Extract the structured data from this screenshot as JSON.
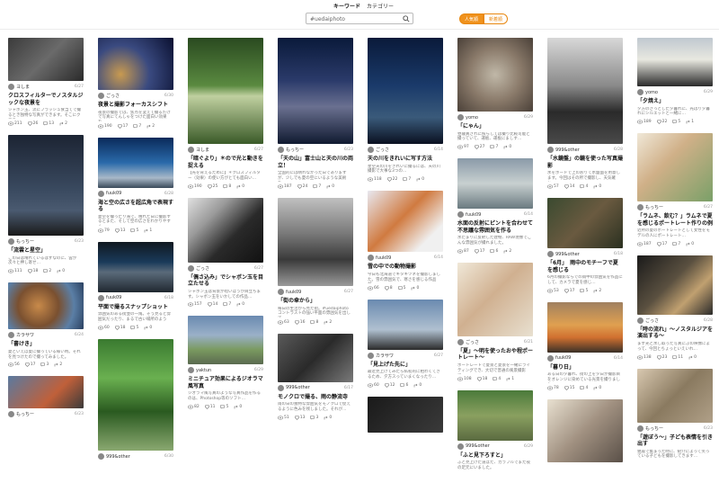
{
  "tabs": [
    {
      "label": "キーワード",
      "active": true
    },
    {
      "label": "カテゴリー",
      "active": false
    }
  ],
  "search": {
    "value": "#uedaiphoto"
  },
  "toggle": {
    "on": "人気順",
    "off": "新着順"
  },
  "columns": [
    [
      {
        "user": "ヨしま",
        "date": "6/27",
        "title": "クロスフィルターでノスタルジックな夜景を",
        "desc": "シャボン玉、流にフラッシュ食当てで撮るとき独特な写真ができます。そこにクロス…",
        "views": "211",
        "likes": "26",
        "comments": "13",
        "shares": "2",
        "h": 48,
        "bg": "linear-gradient(135deg,#3b3b3b 0%,#6a6a6a 50%,#2a2a2a 100%)"
      },
      {
        "user": "もっちー",
        "date": "6/23",
        "title": "「流雲と星空」",
        "desc": "この日は晴れているはずなのに、雲が次々と押し寄せ…",
        "views": "111",
        "likes": "18",
        "comments": "2",
        "shares": "0",
        "h": 112,
        "bg": "linear-gradient(180deg,#1c2433 0%,#3a4a60 55%,#4a5a70 75%,#1a1a1a 100%)"
      },
      {
        "user": "カラサワ",
        "date": "6/24",
        "title": "「書けき」",
        "desc": "夏といえば夏に撮っている様い時。それを見つけたので撮ってみました。",
        "views": "56",
        "likes": "17",
        "comments": "3",
        "shares": "2",
        "h": 52,
        "bg": "radial-gradient(circle at 40% 50%,#c88a4a 0%,#7a5030 40%,#5b7fa6 70%,#2a4060 100%)"
      },
      {
        "user": "もっちー",
        "date": "6/23",
        "title": "",
        "desc": "",
        "views": "",
        "likes": "",
        "comments": "",
        "shares": "",
        "h": 36,
        "bg": "linear-gradient(135deg,#5a7aa0 0%,#c0603a 60%,#3a3a3a 100%)"
      }
    ],
    [
      {
        "user": "ごっさ",
        "date": "6/30",
        "title": "夜景と撮影フォーカスシフト",
        "desc": "夜景の撮影では、焦点を変えて撮るだけで写真にてんしゃをつけた面白い効果を…",
        "views": "190",
        "likes": "17",
        "comments": "7",
        "shares": "2",
        "h": 58,
        "bg": "radial-gradient(circle at 30% 70%,#c89a50 0%,#3a4a80 45%,#0a1030 100%)"
      },
      {
        "user": "fuuk09",
        "date": "6/28",
        "title": "海と空の広さを超広角で表現する",
        "desc": "夏空を撮ったり海で、晴れた日に撮影するとまた、そして空の広さをわかりやすく…",
        "views": "79",
        "likes": "13",
        "comments": "5",
        "shares": "1",
        "h": 56,
        "bg": "linear-gradient(180deg,#0a2a5a 0%,#2a6aaa 50%,#a8b8c8 80%,#3a4a5a 100%)"
      },
      {
        "user": "fuuk09",
        "date": "6/18",
        "title": "平面で撮るスナップショット",
        "desc": "雰囲気のある街並の一角。そう見ると雰囲気だったり、まるで古い場所のように…",
        "views": "60",
        "likes": "18",
        "comments": "5",
        "shares": "0",
        "h": 56,
        "bg": "linear-gradient(180deg,#101820 0%,#1a3a5a 40%,#5a6a7a 60%,#202830 100%)"
      },
      {
        "user": "999&other",
        "date": "6/30",
        "title": "",
        "desc": "",
        "views": "",
        "likes": "",
        "comments": "",
        "shares": "",
        "h": 124,
        "bg": "linear-gradient(180deg,#3a7a30 0%,#6ab050 35%,#2a5a20 65%,#8aa870 100%)"
      }
    ],
    [
      {
        "user": "ヨしま",
        "date": "6/27",
        "title": "「暗ぐより」＊ので光と動きを捉える",
        "desc": "【光を背えるために】＊クロスフィルター（効果）の使い方がとても面白い…",
        "views": "190",
        "likes": "25",
        "comments": "8",
        "shares": "0",
        "h": 118,
        "bg": "linear-gradient(180deg,#2a4a20 0%,#5a8a40 45%,#c0d0a0 55%,#3a5a28 100%)"
      },
      {
        "user": "ごっさ",
        "date": "6/27",
        "title": "「偶さ込み」でシャボン玉を目立たせる",
        "desc": "シャボン玉は背景が暗いほうが目立ちます。シャボン玉をいかしての作品…",
        "views": "157",
        "likes": "14",
        "comments": "7",
        "shares": "0",
        "h": 72,
        "bg": "linear-gradient(135deg,#e0e0e0 0%,#9a9a9a 30%,#2a2a2a 60%,#111 100%)"
      },
      {
        "user": "yaktun",
        "date": "6/29",
        "title": "ミニチュア効果によるジオラマ風写真",
        "desc": "ジオラマ風写真のような写真作品を作るのは、Photoshop等のソフト…",
        "views": "82",
        "likes": "11",
        "comments": "5",
        "shares": "0",
        "h": 54,
        "bg": "linear-gradient(180deg,#6a8ab0 0%,#9ab0c8 40%,#7a9a60 70%,#5a6a50 100%)"
      }
    ],
    [
      {
        "user": "もっちー",
        "date": "6/23",
        "title": "「天の山」富士山と天の川の両立！",
        "desc": "全国的には晴れなかった日でありますが、少しでも夏の空にいるような美術を…",
        "views": "187",
        "likes": "24",
        "comments": "7",
        "shares": "0",
        "h": 118,
        "bg": "linear-gradient(180deg,#0a1a3a 0%,#2a3a6a 40%,#6a7090 65%,#101a30 100%)"
      },
      {
        "user": "fuuk09",
        "date": "6/27",
        "title": "「街の傘から」",
        "desc": "毎日の生活から見た街。#uedaiphoto コントラストの強い平面の雰囲気を出して…",
        "views": "63",
        "likes": "16",
        "comments": "8",
        "shares": "2",
        "h": 98,
        "bg": "linear-gradient(180deg,#c0c0c0 0%,#7a7a7a 40%,#3a3a3a 70%,#9a9a9a 100%)"
      },
      {
        "user": "999&other",
        "date": "6/17",
        "title": "モノクロで撮る、雨の静流寺",
        "desc": "雨の日の独特な雰囲気をモノクロで捉えるように色みを残しました。それが…",
        "views": "51",
        "likes": "13",
        "comments": "3",
        "shares": "0",
        "h": 54,
        "bg": "linear-gradient(135deg,#5a5a5a 0%,#2a2a2a 50%,#7a7a7a 100%)"
      }
    ],
    [
      {
        "user": "ごっさ",
        "date": "6/14",
        "title": "天の川をきれいに写す方法",
        "desc": "星空天の川をきれいに撮るには、天の川撮影で大事な3つの…",
        "views": "118",
        "likes": "22",
        "comments": "7",
        "shares": "0",
        "h": 118,
        "bg": "linear-gradient(180deg,#0a1a3a 0%,#1a3a6a 45%,#3a5a7a 75%,#0a1020 100%)"
      },
      {
        "user": "fuuk09",
        "date": "6/14",
        "title": "雪の中での動物撮影",
        "desc": "今日も北海道でキタキツネを撮影しました。雪の雰囲気で、寒さを感じる作品が…",
        "views": "66",
        "likes": "8",
        "comments": "5",
        "shares": "0",
        "h": 68,
        "bg": "linear-gradient(135deg,#e8e8f0 0%,#d07a40 45%,#f0f0f0 80%)"
      },
      {
        "user": "カラサワ",
        "date": "6/27",
        "title": "「見上げた先に」",
        "desc": "最近見上げてみたら私初的に相わくてきるため、夕方スっていまくなったり…",
        "views": "60",
        "likes": "12",
        "comments": "6",
        "shares": "0",
        "h": 56,
        "bg": "linear-gradient(180deg,#6a8ab0 0%,#b0c0d0 60%,#2a2a2a 100%)"
      },
      {
        "user": "",
        "date": "",
        "title": "",
        "desc": "",
        "views": "",
        "likes": "",
        "comments": "",
        "shares": "",
        "h": 40,
        "bg": "linear-gradient(135deg,#1a1a1a 0%,#3a3a3a 100%)"
      }
    ],
    [
      {
        "user": "yomo",
        "date": "6/29",
        "title": "「にゃん」",
        "desc": "昼寝真されに照らしては撮り比較可能と撮っていて、運板、運板にましす…",
        "views": "97",
        "likes": "27",
        "comments": "7",
        "shares": "0",
        "h": 82,
        "bg": "radial-gradient(circle at 50% 50%,#c0b8a8 0%,#8a7a6a 50%,#4a4038 100%)"
      },
      {
        "user": "fuuk09",
        "date": "6/14",
        "title": "水面の反射にピントを合わせて不思議な雰囲気を作る",
        "desc": "水たまりに反射した建物、RAW現像でこんな雰囲気が撮れました。",
        "views": "87",
        "likes": "17",
        "comments": "6",
        "shares": "2",
        "h": 56,
        "bg": "linear-gradient(180deg,#8a9aa8 0%,#c8d0d0 50%,#6a7a80 100%)"
      },
      {
        "user": "ごっさ",
        "date": "6/21",
        "title": "「夏」～明を使ったおや程ポートレート～",
        "desc": "ポートレートで夏景と夏景を一緒にライティングでき、大切で普通の風景撮影で…",
        "views": "108",
        "likes": "18",
        "comments": "4",
        "shares": "1",
        "h": 82,
        "bg": "linear-gradient(135deg,#f0e8d8 0%,#d0b090 45%,#e8e0d0 100%)"
      },
      {
        "user": "999&other",
        "date": "6/29",
        "title": "「ふと見下ろすと」",
        "desc": "ふと見上げた道ばた、カラフルでまた夜の足元にいました。",
        "views": "",
        "likes": "",
        "comments": "",
        "shares": "",
        "h": 56,
        "bg": "linear-gradient(180deg,#4a7a3a 0%,#8aa060 50%,#5a6a40 100%)"
      }
    ],
    [
      {
        "user": "999&other",
        "date": "6/28",
        "title": "「水鏡盤」の鏡を使った写真撮影",
        "desc": "水をボードで上のおりて水盤面を用意します。今回はその所で撮影し、天気確か…",
        "views": "57",
        "likes": "14",
        "comments": "4",
        "shares": "0",
        "h": 118,
        "bg": "linear-gradient(180deg,#d8d8d8 0%,#8a8a8a 45%,#2a2a2a 70%,#4a4a4a 100%)"
      },
      {
        "user": "999&other",
        "date": "6/18",
        "title": "「6月」　雨中のモチーフで夏を感じる",
        "desc": "6月の撮影ならでの雨中の雰囲気を作品にして、カメラで夏を感じ…",
        "views": "53",
        "likes": "17",
        "comments": "5",
        "shares": "2",
        "h": 56,
        "bg": "linear-gradient(135deg,#3a4a30 0%,#6a5a40 50%,#2a3020 100%)"
      },
      {
        "user": "fuuk09",
        "date": "6/14",
        "title": "「暮り日」",
        "desc": "ある日の夕暮れ、街の上を夕日が撮影目をオレンジに染めている光景を撮りました…",
        "views": "78",
        "likes": "15",
        "comments": "4",
        "shares": "0",
        "h": 56,
        "bg": "linear-gradient(180deg,#a08060 0%,#e0a050 45%,#d07030 70%,#3a3028 100%)"
      },
      {
        "user": "",
        "date": "",
        "title": "",
        "desc": "",
        "views": "",
        "likes": "",
        "comments": "",
        "shares": "",
        "h": 70,
        "bg": "linear-gradient(135deg,#e8e0d0 0%,#a09080 50%,#5a5048 100%)"
      }
    ],
    [
      {
        "user": "yomo",
        "date": "6/29",
        "title": "「夕焼え」",
        "desc": "夕方のさっとした夕暮れに、光はり夕暮れにシルエットと一緒に…",
        "views": "189",
        "likes": "22",
        "comments": "5",
        "shares": "1",
        "h": 54,
        "bg": "linear-gradient(180deg,#c0c8d0 0%,#e8e8e0 45%,#2a2a2a 100%)"
      },
      {
        "user": "もっちー",
        "date": "6/27",
        "title": "「ラムネ、飲む？」ラムネで夏を感じるポートレート作りの例",
        "desc": "近所の夏のポートレートとして女性をモデルの人にポートレート…",
        "views": "187",
        "likes": "17",
        "comments": "7",
        "shares": "0",
        "h": 76,
        "bg": "linear-gradient(135deg,#f0e8d8 0%,#d0b088 40%,#7aa068 100%)"
      },
      {
        "user": "ごっさ",
        "date": "6/28",
        "title": "「時の流れ」～ノスタルジアを演出する～",
        "desc": "まず光と水し取った写真にぷの映像によって、今回とちょっといえいれ…",
        "views": "138",
        "likes": "23",
        "comments": "11",
        "shares": "0",
        "h": 66,
        "bg": "linear-gradient(135deg,#1a1a1a 0%,#5a5040 45%,#c0a070 70%,#2a2a2a 100%)"
      },
      {
        "user": "もっちー",
        "date": "6/23",
        "title": "「遊ぼう～」子ども表情を引き出す",
        "desc": "親戚で集まった時に、紹介によって笑っている子どもを撮影してきます…",
        "views": "",
        "likes": "",
        "comments": "",
        "shares": "",
        "h": 60,
        "bg": "linear-gradient(135deg,#d8c8b0 0%,#8a7a60 50%,#b0a088 100%)"
      }
    ]
  ]
}
